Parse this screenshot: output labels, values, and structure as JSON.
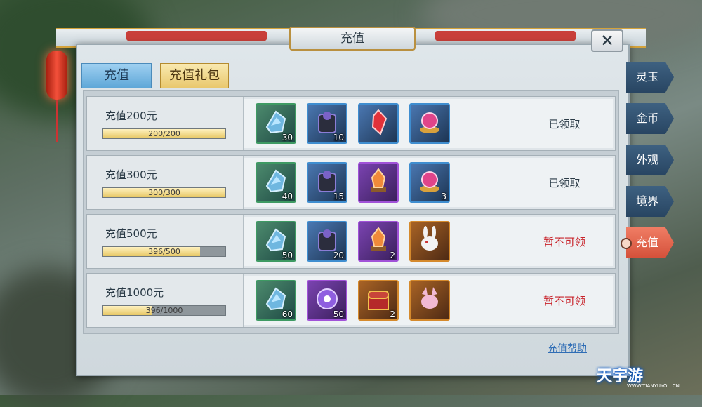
{
  "dialog": {
    "title": "充值",
    "close_symbol": "✕",
    "tabs": [
      "充值",
      "充值礼包"
    ],
    "help_link": "充值帮助"
  },
  "rows": [
    {
      "title": "充值200元",
      "progress_text": "200/200",
      "progress_fraction": 1.0,
      "status": "已领取",
      "status_color": "#2a3a46",
      "items": [
        {
          "icon": "crystal-shard-icon",
          "quality": "green",
          "qty": "30"
        },
        {
          "icon": "dark-armor-icon",
          "quality": "blue",
          "qty": "10"
        },
        {
          "icon": "red-crystal-icon",
          "quality": "blue",
          "qty": ""
        },
        {
          "icon": "pink-orb-icon",
          "quality": "blue",
          "qty": ""
        }
      ]
    },
    {
      "title": "充值300元",
      "progress_text": "300/300",
      "progress_fraction": 1.0,
      "status": "已领取",
      "status_color": "#2a3a46",
      "items": [
        {
          "icon": "crystal-shard-icon",
          "quality": "green",
          "qty": "40"
        },
        {
          "icon": "dark-armor-icon",
          "quality": "blue",
          "qty": "15"
        },
        {
          "icon": "fire-crystal-icon",
          "quality": "purple",
          "qty": ""
        },
        {
          "icon": "pink-orb-icon",
          "quality": "blue",
          "qty": "3"
        }
      ]
    },
    {
      "title": "充值500元",
      "progress_text": "396/500",
      "progress_fraction": 0.792,
      "status": "暂不可领",
      "status_color": "#c8242b",
      "items": [
        {
          "icon": "crystal-shard-icon",
          "quality": "green",
          "qty": "50"
        },
        {
          "icon": "dark-armor-icon",
          "quality": "blue",
          "qty": "20"
        },
        {
          "icon": "fire-crystal-icon",
          "quality": "purple",
          "qty": "2"
        },
        {
          "icon": "white-rabbit-icon",
          "quality": "orange",
          "qty": ""
        }
      ]
    },
    {
      "title": "充值1000元",
      "progress_text": "396/1000",
      "progress_fraction": 0.396,
      "status": "暂不可领",
      "status_color": "#c8242b",
      "items": [
        {
          "icon": "crystal-shard-icon",
          "quality": "green",
          "qty": "60"
        },
        {
          "icon": "purple-orb-icon",
          "quality": "purple",
          "qty": "50"
        },
        {
          "icon": "treasure-chest-icon",
          "quality": "orange",
          "qty": "2"
        },
        {
          "icon": "pink-pet-icon",
          "quality": "orange",
          "qty": ""
        }
      ]
    }
  ],
  "side_tabs": [
    "灵玉",
    "金币",
    "外观",
    "境界",
    "充值"
  ],
  "active_side_tab": 4,
  "watermark": {
    "title": "天宇游",
    "url": "WWW.TIANYUYOU.CN"
  }
}
